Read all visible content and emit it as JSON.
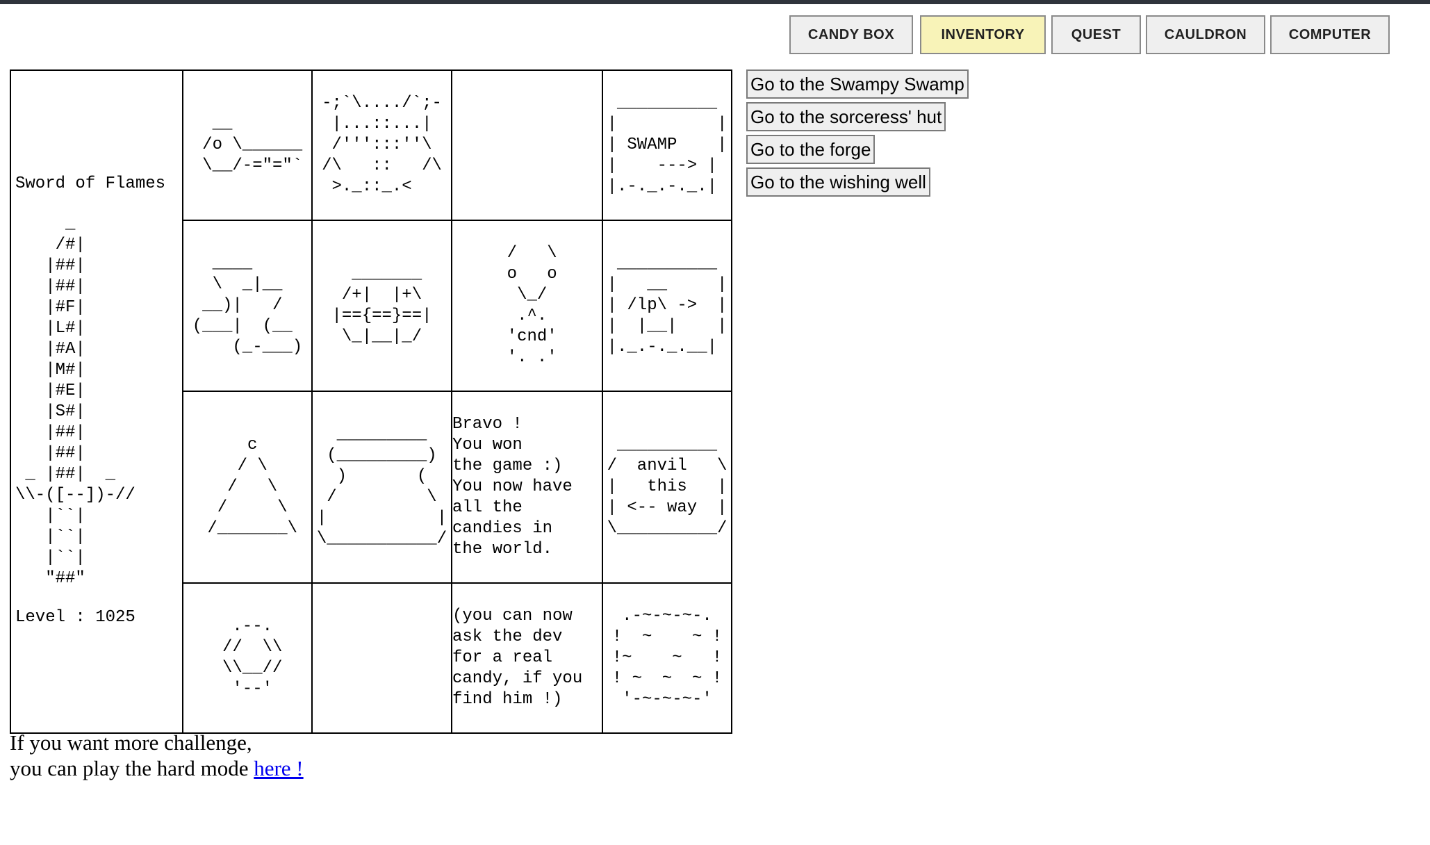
{
  "tabs": [
    {
      "label": "CANDY BOX",
      "active": false
    },
    {
      "label": "INVENTORY",
      "active": true
    },
    {
      "label": "QUEST",
      "active": false
    },
    {
      "label": "CAULDRON",
      "active": false
    },
    {
      "label": "COMPUTER",
      "active": false
    }
  ],
  "inventory": {
    "sword_name": "Sword of Flames",
    "sword_art": "     _\n    /#|\n   |##|\n   |##|\n   |#F|\n   |L#|\n   |#A|\n   |M#|\n   |#E|\n   |S#|\n   |##|\n   |##|\n _ |##|  _\n\\\\-([--])-//\n   |``|\n   |``|\n   |``|\n   \"##\"",
    "level_text": "Level : 1025",
    "items": [
      [
        "  __\n /o \\______\n \\__/-=\"=\"`",
        "-;`\\..../`;-\n |...::...|\n /''':::''\\\n/\\   ::   /\\\n >._::_.<",
        "",
        " __________\n|          |\n| SWAMP    |\n|    ---> |\n|.-._.-._.|"
      ],
      [
        "  ____\n  \\  _|__\n __)|   /\n(___|  (__\n    (_-___)",
        "  _______\n /+|  |+\\\n|=={==}==|\n \\_|__|_/",
        " /   \\\n o   o\n  \\_/\n  .^.\n 'cnd'\n '. .'",
        " __________\n|   __     |\n| /lp\\ ->  |\n|  |__|    |\n|._.-._.__|"
      ],
      [
        "     c\n    / \\\n   /   \\\n  /     \\\n /_______\\",
        "  _________\n (_________)\n  )       (\n /         \\\n|           |\n\\___________/",
        "",
        " __________\n/  anvil   \\\n|   this   |\n| <-- way  |\n\\__________/"
      ],
      [
        "  .--.\n //  \\\\\n \\\\__//\n  '--'",
        "",
        "",
        " .-~-~-~-.\n!  ~    ~ !\n!~    ~   !\n! ~  ~  ~ !\n '-~-~-~-'"
      ]
    ],
    "won_message": "Bravo !\nYou won\nthe game :)\nYou now have\nall the\ncandies in\nthe world.",
    "dev_message": "(you can now\nask the dev\nfor a real\ncandy, if you\nfind him !)"
  },
  "actions": [
    "Go to the Swampy Swamp",
    "Go to the sorceress' hut",
    "Go to the forge",
    "Go to the wishing well"
  ],
  "footer": {
    "line1": "If you want more challenge,",
    "line2": "you can play the hard mode ",
    "link": "here !"
  }
}
